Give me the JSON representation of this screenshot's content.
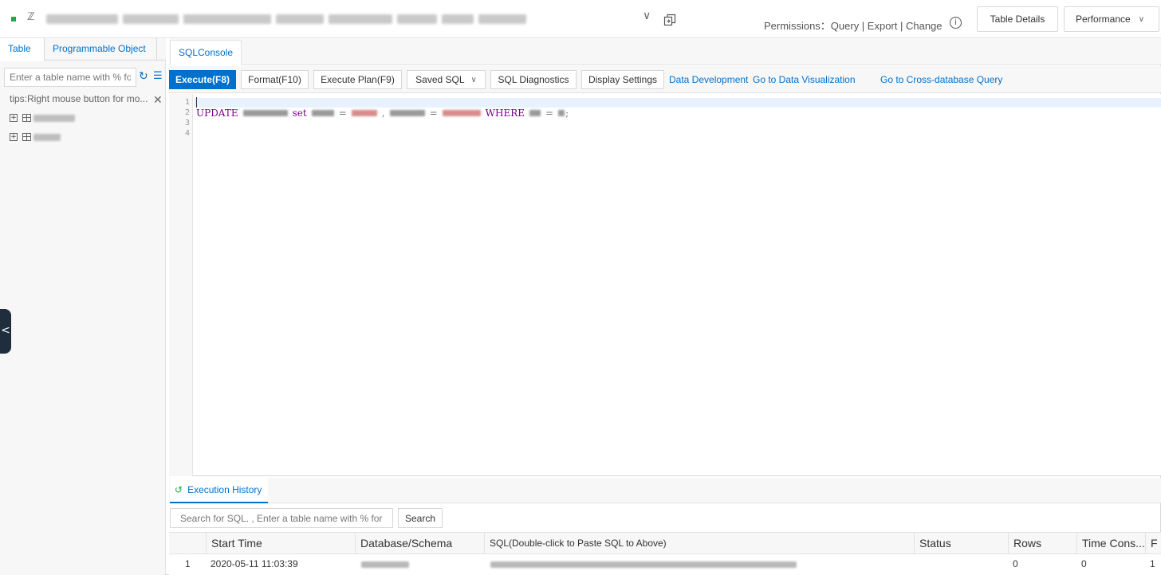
{
  "header": {
    "permissions_text": "Permissions：Query | Export | Change",
    "table_details_label": "Table Details",
    "performance_label": "Performance",
    "caret": "∨",
    "conn_glyph": "ℤ",
    "info_glyph": "i",
    "icons": {
      "info": "info-icon",
      "copy": "copy-icon",
      "status": "connection-status-icon"
    },
    "colors": {
      "status_dot": "#1aab4a"
    }
  },
  "left_panel": {
    "tabs": [
      {
        "label": "Table",
        "active": true
      },
      {
        "label": "Programmable Object",
        "active": false
      }
    ],
    "search_placeholder": "Enter a table name with % fo",
    "tips": "tips:Right mouse button for mo...",
    "expand_glyph": "+",
    "refresh_glyph": "↻",
    "tree_glyph": "☰",
    "close_glyph": "✕",
    "collapse_glyph": "<"
  },
  "console": {
    "tab_label": "SQLConsole",
    "toolbar": {
      "execute": "Execute(F8)",
      "format": "Format(F10)",
      "execute_plan": "Execute Plan(F9)",
      "saved_sql": "Saved SQL",
      "sql_diagnostics": "SQL Diagnostics",
      "display_settings": "Display Settings",
      "data_development": "Data Development",
      "data_visualization": "Go to Data Visualization",
      "cross_db_query": "Go to Cross-database Query"
    },
    "editor": {
      "line_numbers": [
        "1",
        "2",
        "3",
        "4"
      ],
      "keyword_update": "UPDATE",
      "keyword_set": "set",
      "op_eq": "=",
      "comma": ",",
      "keyword_where": "WHERE",
      "semicolon": ";"
    },
    "colors": {
      "primary": "#0070cc",
      "keyword": "#770088"
    }
  },
  "history": {
    "tab_label": "Execution History",
    "tab_glyph": "↺",
    "search_placeholder": "Search for SQL. , Enter a table name with % for",
    "search_button": "Search",
    "columns": [
      "Start Time",
      "Database/Schema",
      "SQL(Double-click to Paste SQL to Above)",
      "Status",
      "Rows",
      "Time Cons...",
      "F"
    ],
    "rows": [
      {
        "index": "1",
        "start_time": "2020-05-11 11:03:39",
        "status": "",
        "rows": "0",
        "time": "0",
        "extra": "1"
      }
    ]
  }
}
